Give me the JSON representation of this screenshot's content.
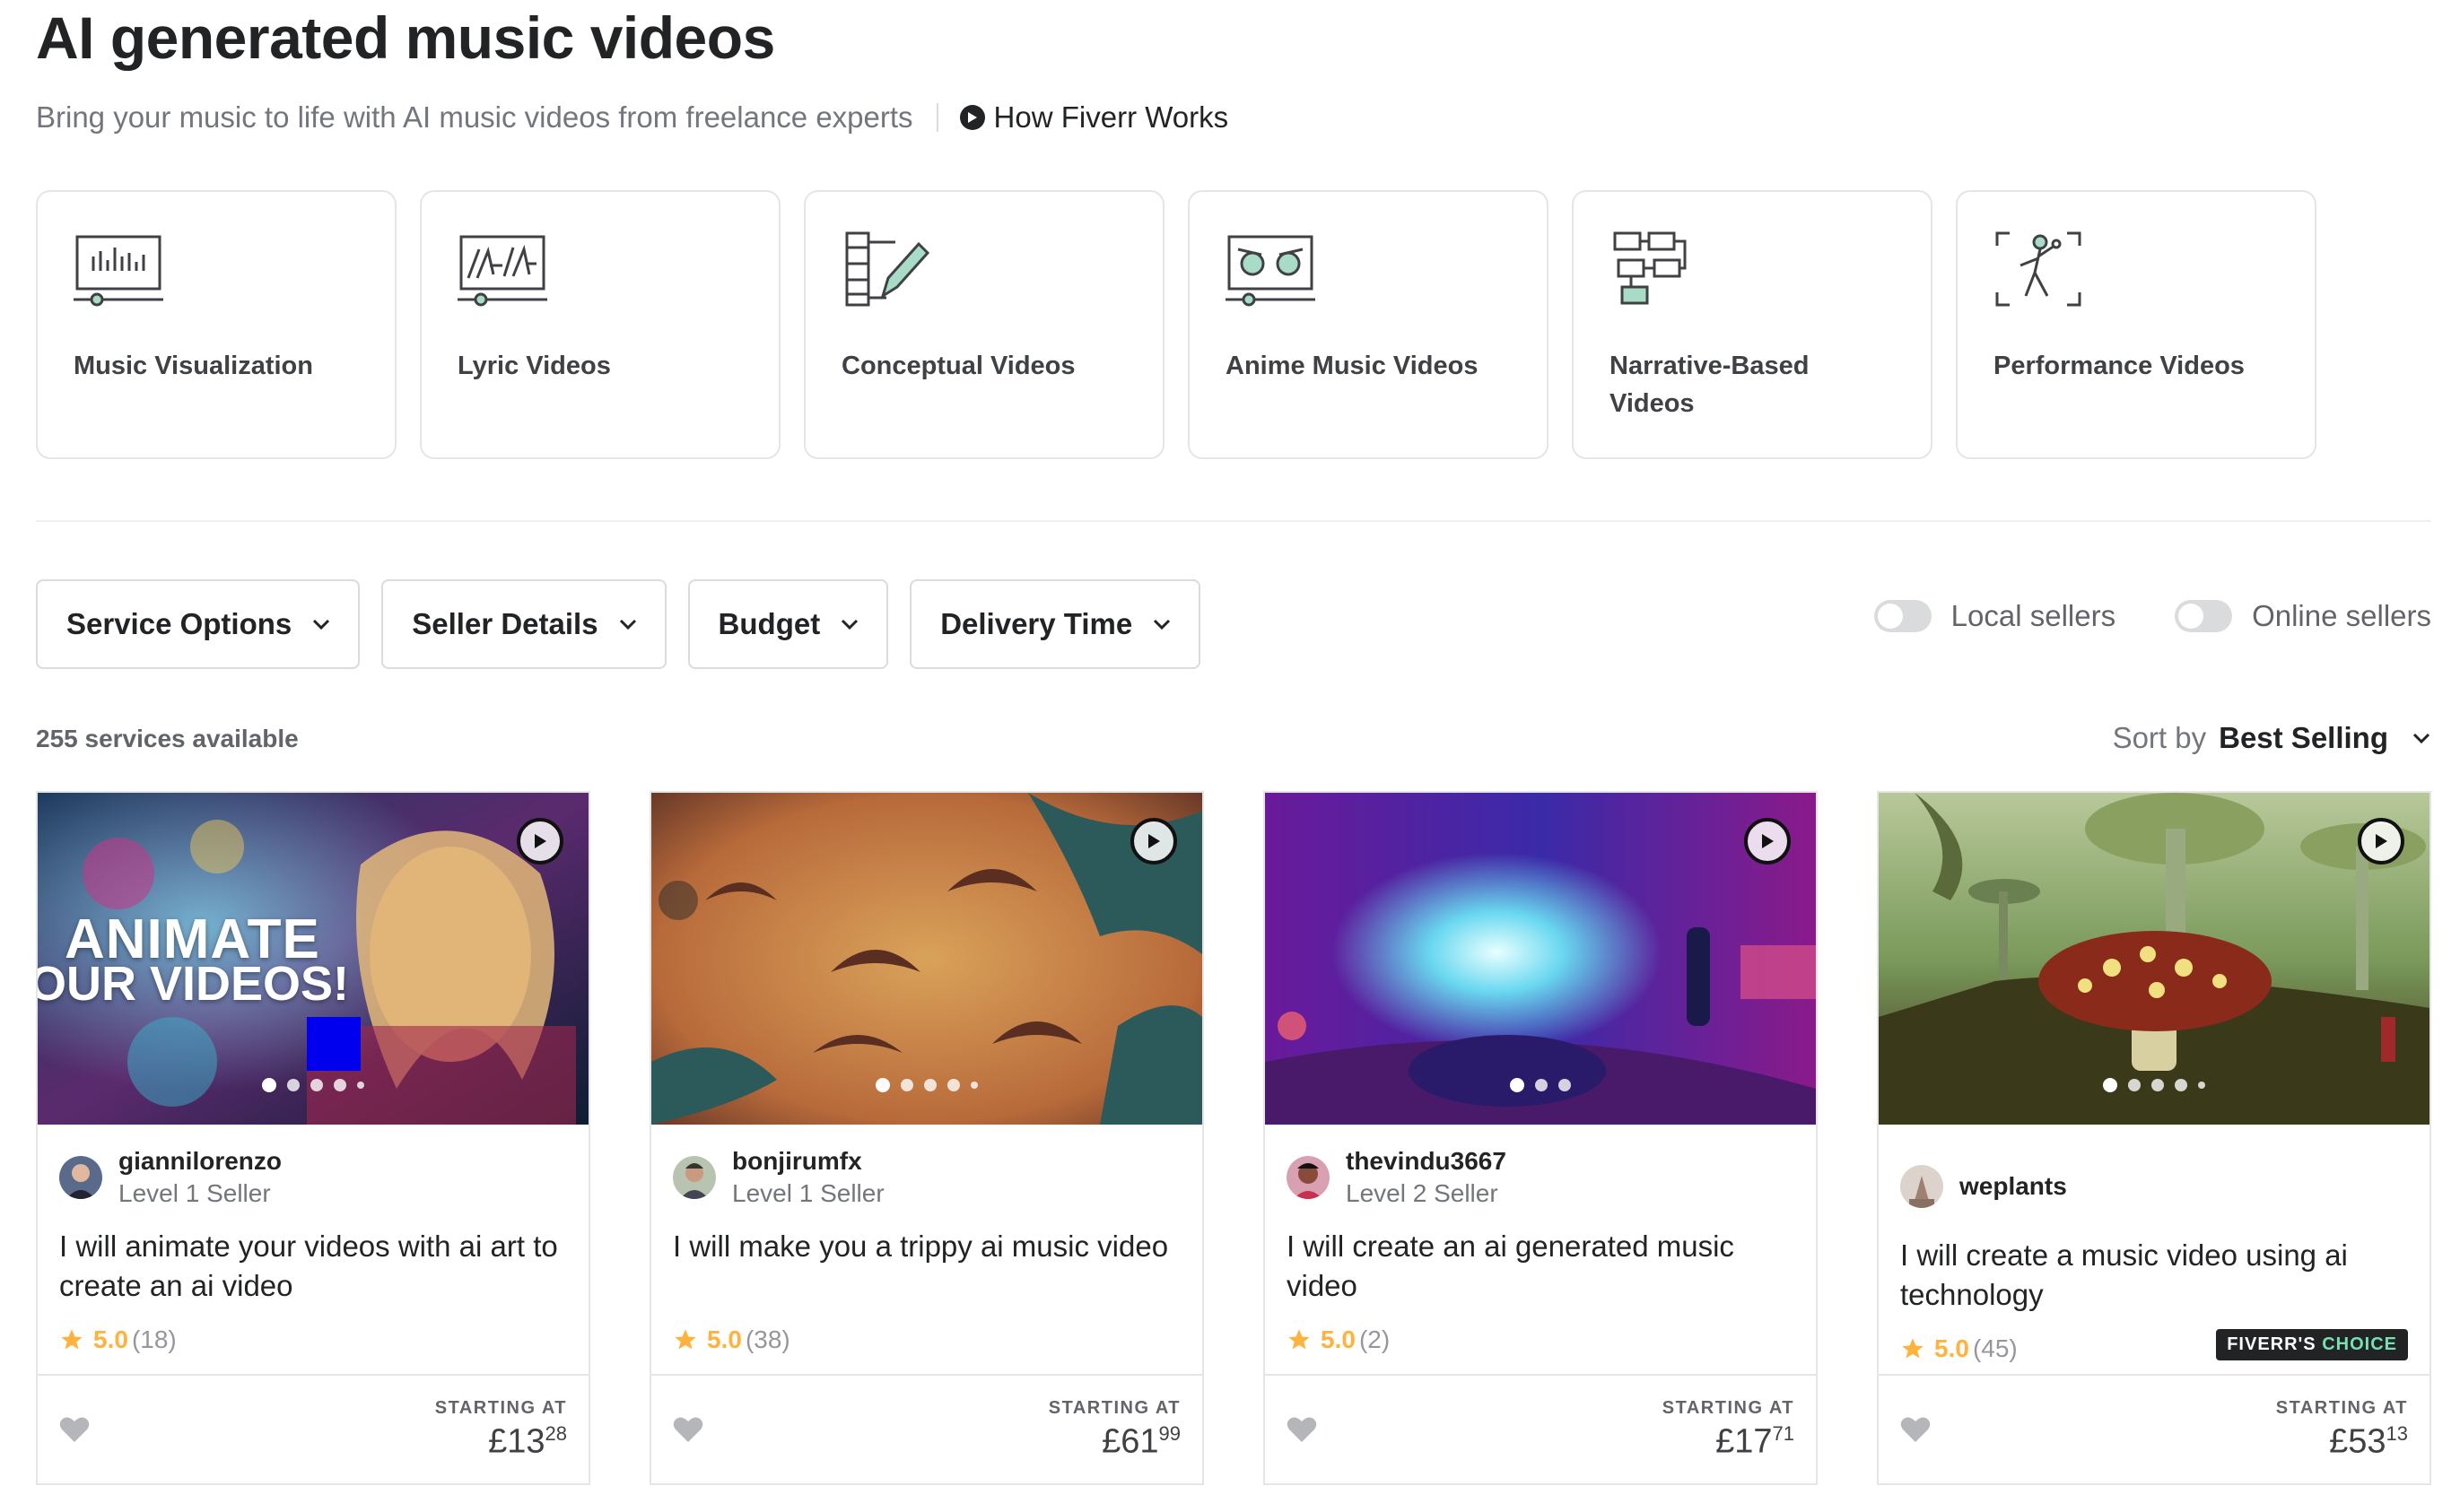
{
  "header": {
    "title": "AI generated music videos",
    "subtitle": "Bring your music to life with AI music videos from freelance experts",
    "how_link": "How Fiverr Works"
  },
  "categories": [
    {
      "label": "Music Visualization",
      "icon": "waveform-screen-icon"
    },
    {
      "label": "Lyric Videos",
      "icon": "lyrics-screen-icon"
    },
    {
      "label": "Conceptual Videos",
      "icon": "film-pencil-icon"
    },
    {
      "label": "Anime Music Videos",
      "icon": "anime-eyes-screen-icon"
    },
    {
      "label": "Narrative-Based Videos",
      "icon": "storyboard-icon"
    },
    {
      "label": "Performance Videos",
      "icon": "performer-icon"
    }
  ],
  "filters": {
    "service_options": "Service Options",
    "seller_details": "Seller Details",
    "budget": "Budget",
    "delivery_time": "Delivery Time"
  },
  "toggles": {
    "local_sellers": "Local sellers",
    "online_sellers": "Online sellers"
  },
  "results": {
    "count": "255 services available",
    "sort_label": "Sort by",
    "sort_value": "Best Selling"
  },
  "cards": [
    {
      "seller": "giannilorenzo",
      "level": "Level 1 Seller",
      "title": "I will animate your videos with ai art to create an ai video",
      "score": "5.0",
      "reviews": "(18)",
      "starting_label": "STARTING AT",
      "price_main": "£13",
      "price_cents": "28",
      "thumb_text_1": "ANIMATE",
      "thumb_text_2": "OUR VIDEOS!"
    },
    {
      "seller": "bonjirumfx",
      "level": "Level 1 Seller",
      "title": "I will make you a trippy ai music video",
      "score": "5.0",
      "reviews": "(38)",
      "starting_label": "STARTING AT",
      "price_main": "£61",
      "price_cents": "99"
    },
    {
      "seller": "thevindu3667",
      "level": "Level 2 Seller",
      "title": "I will create an ai generated music video",
      "score": "5.0",
      "reviews": "(2)",
      "starting_label": "STARTING AT",
      "price_main": "£17",
      "price_cents": "71"
    },
    {
      "seller": "weplants",
      "level": "",
      "title": "I will create a music video using ai technology",
      "score": "5.0",
      "reviews": "(45)",
      "badge_1": "FIVERR'S ",
      "badge_2": "CHOICE",
      "starting_label": "STARTING AT",
      "price_main": "£53",
      "price_cents": "13"
    }
  ],
  "colors": {
    "text_dark": "#222325",
    "text_muted": "#74767e",
    "star": "#ffb33e",
    "border": "#e4e5e7",
    "choice_highlight": "#74e2b3"
  }
}
